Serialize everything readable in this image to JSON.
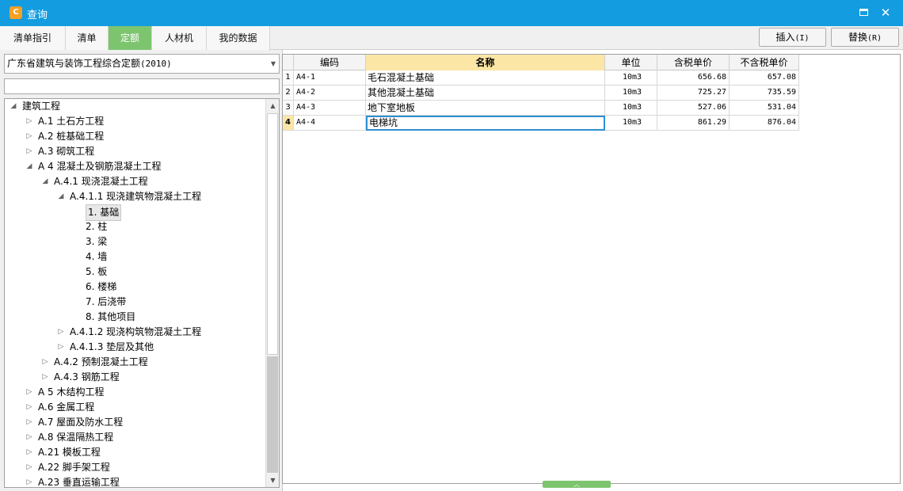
{
  "window": {
    "title": "查询",
    "icon": "app-logo-icon"
  },
  "tabs": [
    {
      "label": "清单指引",
      "active": false
    },
    {
      "label": "清单",
      "active": false
    },
    {
      "label": "定额",
      "active": true
    },
    {
      "label": "人材机",
      "active": false
    },
    {
      "label": "我的数据",
      "active": false
    }
  ],
  "toolbar": {
    "insert_label": "插入",
    "insert_shortcut": "(I)",
    "replace_label": "替换",
    "replace_shortcut": "(R)"
  },
  "quota_library": {
    "selected": "广东省建筑与装饰工程综合定额",
    "selected_year": "(2010)"
  },
  "search": {
    "value": ""
  },
  "tree": {
    "nodes": [
      {
        "label": "建筑工程",
        "level": 0,
        "state": "expanded"
      },
      {
        "label": "A.1 土石方工程",
        "level": 1,
        "state": "collapsed"
      },
      {
        "label": "A.2 桩基础工程",
        "level": 1,
        "state": "collapsed"
      },
      {
        "label": "A.3 砌筑工程",
        "level": 1,
        "state": "collapsed"
      },
      {
        "label": "A 4 混凝土及钢筋混凝土工程",
        "level": 1,
        "state": "expanded"
      },
      {
        "label": "A.4.1 现浇混凝土工程",
        "level": 2,
        "state": "expanded"
      },
      {
        "label": "A.4.1.1 现浇建筑物混凝土工程",
        "level": 3,
        "state": "expanded"
      },
      {
        "label": "1. 基础",
        "level": 4,
        "state": "leaf",
        "selected": true
      },
      {
        "label": "2. 柱",
        "level": 4,
        "state": "leaf"
      },
      {
        "label": "3. 梁",
        "level": 4,
        "state": "leaf"
      },
      {
        "label": "4. 墙",
        "level": 4,
        "state": "leaf"
      },
      {
        "label": "5. 板",
        "level": 4,
        "state": "leaf"
      },
      {
        "label": "6. 楼梯",
        "level": 4,
        "state": "leaf"
      },
      {
        "label": "7. 后浇带",
        "level": 4,
        "state": "leaf"
      },
      {
        "label": "8. 其他项目",
        "level": 4,
        "state": "leaf"
      },
      {
        "label": "A.4.1.2 现浇构筑物混凝土工程",
        "level": 3,
        "state": "collapsed"
      },
      {
        "label": "A.4.1.3 垫层及其他",
        "level": 3,
        "state": "collapsed"
      },
      {
        "label": "A.4.2 预制混凝土工程",
        "level": 2,
        "state": "collapsed"
      },
      {
        "label": "A.4.3 钢筋工程",
        "level": 2,
        "state": "collapsed"
      },
      {
        "label": "A 5 木结构工程",
        "level": 1,
        "state": "collapsed"
      },
      {
        "label": "A.6 金属工程",
        "level": 1,
        "state": "collapsed"
      },
      {
        "label": "A.7 屋面及防水工程",
        "level": 1,
        "state": "collapsed"
      },
      {
        "label": "A.8 保温隔热工程",
        "level": 1,
        "state": "collapsed"
      },
      {
        "label": "A.21 模板工程",
        "level": 1,
        "state": "collapsed"
      },
      {
        "label": "A.22 脚手架工程",
        "level": 1,
        "state": "collapsed"
      },
      {
        "label": "A.23 垂直运输工程",
        "level": 1,
        "state": "collapsed"
      }
    ]
  },
  "grid": {
    "columns": [
      "",
      "编码",
      "名称",
      "单位",
      "含税单价",
      "不含税单价"
    ],
    "active_column": "名称",
    "current_row": 4,
    "rows": [
      {
        "idx": "1",
        "code": "A4-1",
        "name": "毛石混凝土基础",
        "unit": "10m3",
        "price_tax": "656.68",
        "price_notax": "657.08"
      },
      {
        "idx": "2",
        "code": "A4-2",
        "name": "其他混凝土基础",
        "unit": "10m3",
        "price_tax": "725.27",
        "price_notax": "735.59"
      },
      {
        "idx": "3",
        "code": "A4-3",
        "name": "地下室地板",
        "unit": "10m3",
        "price_tax": "527.06",
        "price_notax": "531.04"
      },
      {
        "idx": "4",
        "code": "A4-4",
        "name": "电梯坑",
        "unit": "10m3",
        "price_tax": "861.29",
        "price_notax": "876.04"
      }
    ]
  },
  "colors": {
    "titlebar": "#139ce0",
    "active_tab": "#7dc46f",
    "active_header": "#fbe6a6",
    "focus_border": "#2f8fd1"
  }
}
